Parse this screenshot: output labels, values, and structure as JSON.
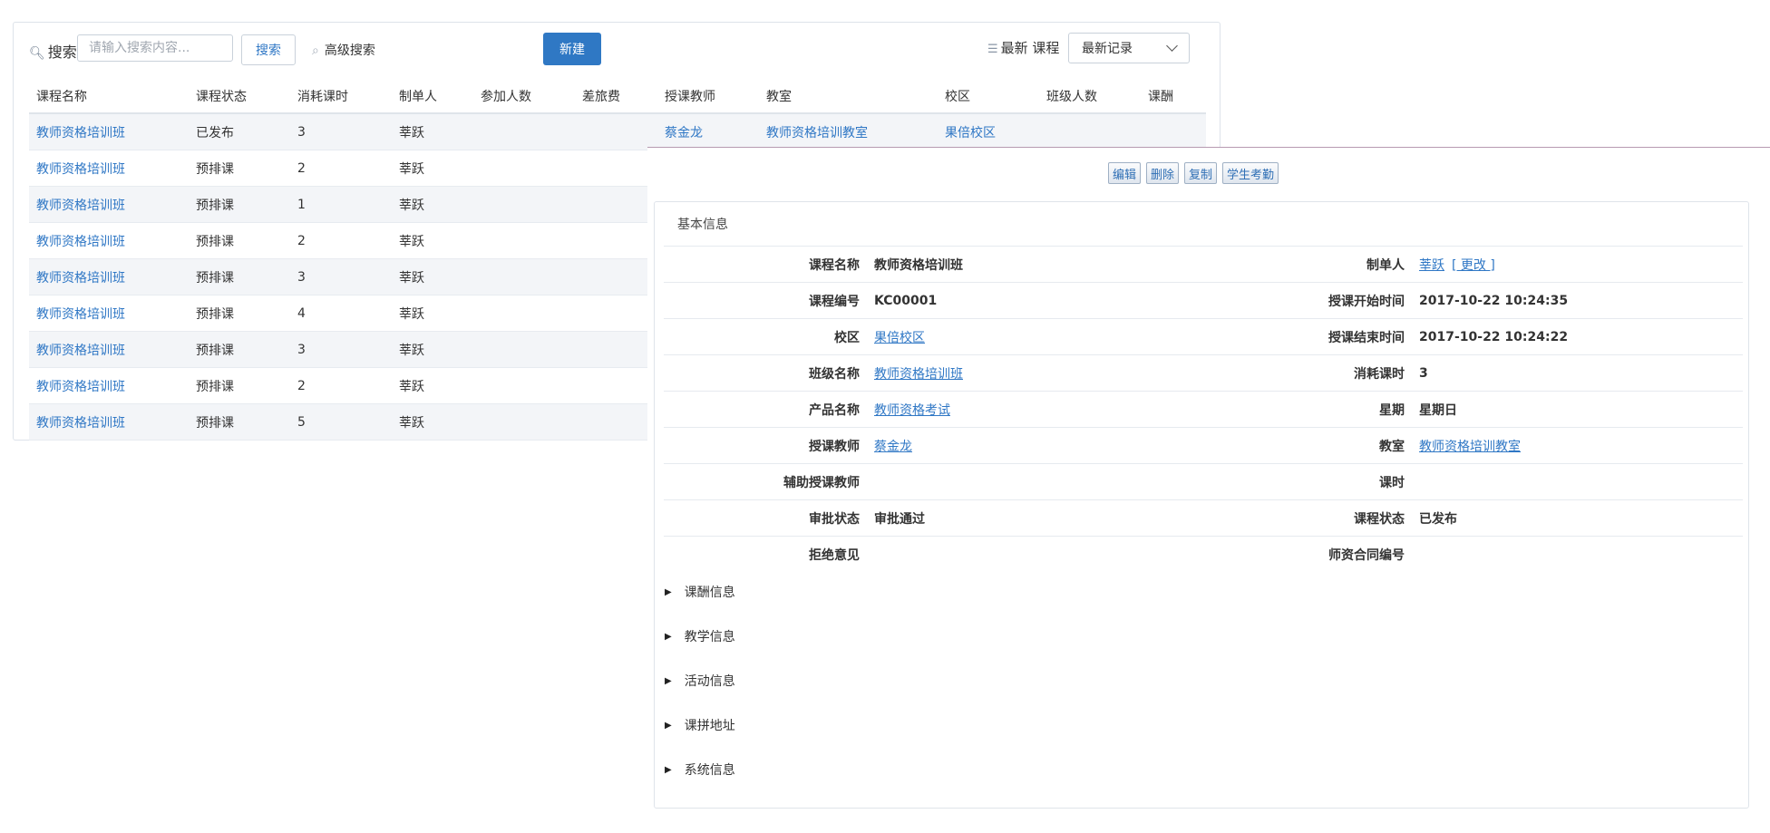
{
  "toolbar": {
    "search_label": "搜索",
    "search_placeholder": "请输入搜索内容...",
    "search_button": "搜索",
    "advanced_search": "高级搜索",
    "new_button": "新建",
    "latest_label": "最新 课程",
    "latest_select": "最新记录"
  },
  "table": {
    "headers": [
      "课程名称",
      "课程状态",
      "消耗课时",
      "制单人",
      "参加人数",
      "差旅费",
      "授课教师",
      "教室",
      "校区",
      "班级人数",
      "课酬"
    ],
    "rows": [
      {
        "name": "教师资格培训班",
        "status": "已发布",
        "hours": "3",
        "maker": "莘跃",
        "teacher": "蔡金龙",
        "room": "教师资格培训教室",
        "campus": "果倍校区"
      },
      {
        "name": "教师资格培训班",
        "status": "预排课",
        "hours": "2",
        "maker": "莘跃"
      },
      {
        "name": "教师资格培训班",
        "status": "预排课",
        "hours": "1",
        "maker": "莘跃"
      },
      {
        "name": "教师资格培训班",
        "status": "预排课",
        "hours": "2",
        "maker": "莘跃"
      },
      {
        "name": "教师资格培训班",
        "status": "预排课",
        "hours": "3",
        "maker": "莘跃"
      },
      {
        "name": "教师资格培训班",
        "status": "预排课",
        "hours": "4",
        "maker": "莘跃"
      },
      {
        "name": "教师资格培训班",
        "status": "预排课",
        "hours": "3",
        "maker": "莘跃"
      },
      {
        "name": "教师资格培训班",
        "status": "预排课",
        "hours": "2",
        "maker": "莘跃"
      },
      {
        "name": "教师资格培训班",
        "status": "预排课",
        "hours": "5",
        "maker": "莘跃"
      }
    ]
  },
  "detail": {
    "actions": [
      "编辑",
      "删除",
      "复制",
      "学生考勤"
    ],
    "section_title": "基本信息",
    "fields": {
      "course_name_label": "课程名称",
      "course_name": "教师资格培训班",
      "maker_label": "制单人",
      "maker": "莘跃",
      "maker_change": "[ 更改 ]",
      "course_code_label": "课程编号",
      "course_code": "KC00001",
      "start_time_label": "授课开始时间",
      "start_time": "2017-10-22 10:24:35",
      "campus_label": "校区",
      "campus": "果倍校区",
      "end_time_label": "授课结束时间",
      "end_time": "2017-10-22 10:24:22",
      "class_name_label": "班级名称",
      "class_name": "教师资格培训班",
      "hours_label": "消耗课时",
      "hours": "3",
      "product_label": "产品名称",
      "product": "教师资格考试",
      "weekday_label": "星期",
      "weekday": "星期日",
      "teacher_label": "授课教师",
      "teacher": "蔡金龙",
      "room_label": "教室",
      "room": "教师资格培训教室",
      "assistant_label": "辅助授课教师",
      "assistant": "",
      "period_label": "课时",
      "period": "",
      "approval_label": "审批状态",
      "approval": "审批通过",
      "status_label": "课程状态",
      "status": "已发布",
      "reject_label": "拒绝意见",
      "reject": "",
      "contract_label": "师资合同编号",
      "contract": ""
    },
    "collapsed_sections": [
      "课酬信息",
      "教学信息",
      "活动信息",
      "课拼地址",
      "系统信息"
    ]
  }
}
